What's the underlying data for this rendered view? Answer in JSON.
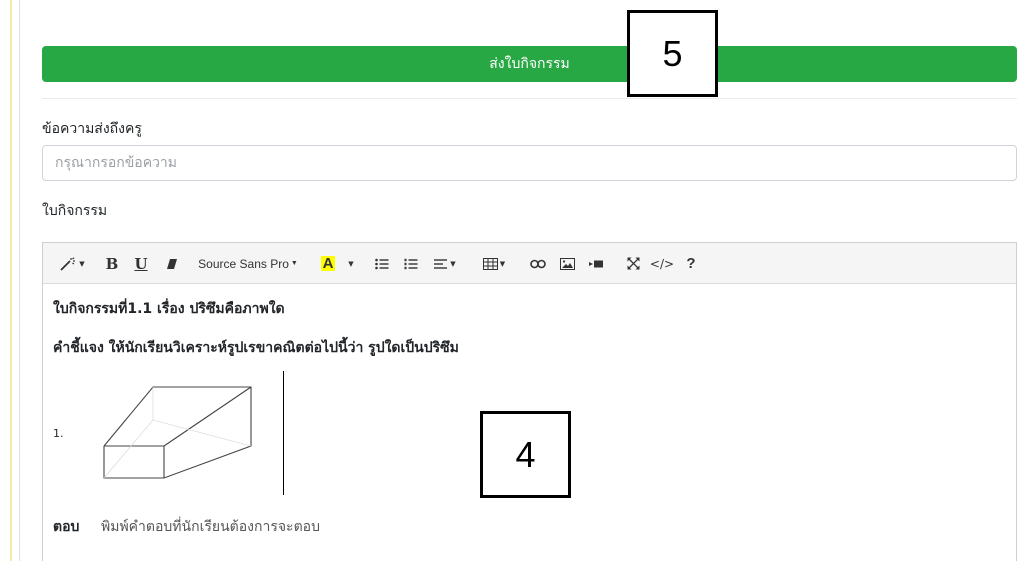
{
  "form": {
    "submit_label": "ส่งใบกิจกรรม",
    "message_label": "ข้อความส่งถึงครู",
    "message_placeholder": "กรุณากรอกข้อความ",
    "message_value": "",
    "worksheet_label": "ใบกิจกรรม"
  },
  "editor": {
    "toolbar": {
      "font_name": "Source Sans Pro",
      "color_letter": "A",
      "bold_letter": "B",
      "underline_letter": "U",
      "code_label": "</>",
      "help_label": "?"
    },
    "content": {
      "title": "ใบกิจกรรมที่1.1 เรื่อง ปริซึมคือภาพใด",
      "instruction": "คำชี้แจง ให้นักเรียนวิเคราะห์รูปเรขาคณิตต่อไปนี้ว่า รูปใดเป็นปริซึม",
      "item_number": "1.",
      "answer_label": "ตอบ",
      "answer_placeholder": "พิมพ์คำตอบที่นักเรียนต้องการจะตอบ"
    }
  },
  "annotations": [
    {
      "label": "5"
    },
    {
      "label": "4"
    }
  ],
  "colors": {
    "submit_button": "#28a745",
    "toolbar_bg": "#f5f5f5",
    "highlight_yellow": "#ffff00"
  }
}
